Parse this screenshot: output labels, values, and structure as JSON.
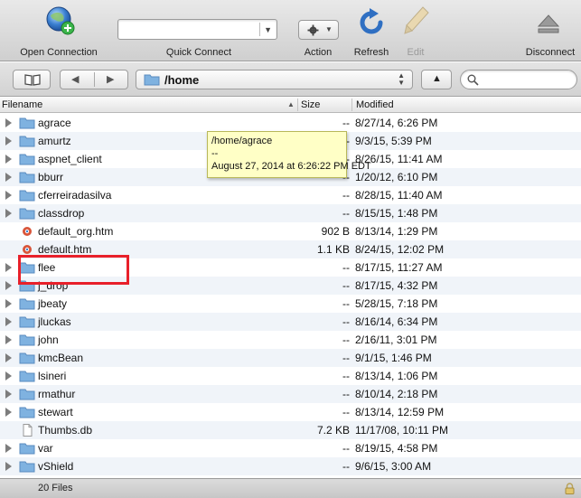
{
  "toolbar": {
    "open_connection": "Open Connection",
    "quick_connect": "Quick Connect",
    "action": "Action",
    "refresh": "Refresh",
    "edit": "Edit",
    "disconnect": "Disconnect"
  },
  "nav": {
    "path": "/home",
    "search_placeholder": ""
  },
  "columns": {
    "filename": "Filename",
    "size": "Size",
    "modified": "Modified"
  },
  "files": [
    {
      "name": "agrace",
      "size": "--",
      "modified": "8/27/14, 6:26 PM",
      "type": "folder"
    },
    {
      "name": "amurtz",
      "size": "--",
      "modified": "9/3/15, 5:39 PM",
      "type": "folder"
    },
    {
      "name": "aspnet_client",
      "size": "--",
      "modified": "8/26/15, 11:41 AM",
      "type": "folder"
    },
    {
      "name": "bburr",
      "size": "--",
      "modified": "1/20/12, 6:10 PM",
      "type": "folder"
    },
    {
      "name": "cferreiradasilva",
      "size": "--",
      "modified": "8/28/15, 11:40 AM",
      "type": "folder"
    },
    {
      "name": "classdrop",
      "size": "--",
      "modified": "8/15/15, 1:48 PM",
      "type": "folder"
    },
    {
      "name": "default_org.htm",
      "size": "902 B",
      "modified": "8/13/14, 1:29 PM",
      "type": "html"
    },
    {
      "name": "default.htm",
      "size": "1.1 KB",
      "modified": "8/24/15, 12:02 PM",
      "type": "html"
    },
    {
      "name": "flee",
      "size": "--",
      "modified": "8/17/15, 11:27 AM",
      "type": "folder"
    },
    {
      "name": "j_drop",
      "size": "--",
      "modified": "8/17/15, 4:32 PM",
      "type": "folder"
    },
    {
      "name": "jbeaty",
      "size": "--",
      "modified": "5/28/15, 7:18 PM",
      "type": "folder"
    },
    {
      "name": "jluckas",
      "size": "--",
      "modified": "8/16/14, 6:34 PM",
      "type": "folder"
    },
    {
      "name": "john",
      "size": "--",
      "modified": "2/16/11, 3:01 PM",
      "type": "folder"
    },
    {
      "name": "kmcBean",
      "size": "--",
      "modified": "9/1/15, 1:46 PM",
      "type": "folder"
    },
    {
      "name": "lsineri",
      "size": "--",
      "modified": "8/13/14, 1:06 PM",
      "type": "folder"
    },
    {
      "name": "rmathur",
      "size": "--",
      "modified": "8/10/14, 2:18 PM",
      "type": "folder"
    },
    {
      "name": "stewart",
      "size": "--",
      "modified": "8/13/14, 12:59 PM",
      "type": "folder"
    },
    {
      "name": "Thumbs.db",
      "size": "7.2 KB",
      "modified": "11/17/08, 10:11 PM",
      "type": "file"
    },
    {
      "name": "var",
      "size": "--",
      "modified": "8/19/15, 4:58 PM",
      "type": "folder"
    },
    {
      "name": "vShield",
      "size": "--",
      "modified": "9/6/15, 3:00 AM",
      "type": "folder"
    }
  ],
  "tooltip": {
    "path": "/home/agrace",
    "size": "--",
    "date": "August 27, 2014 at 6:26:22 PM EDT"
  },
  "status": {
    "count": "20 Files"
  },
  "colors": {
    "folder": "#7fb2e0",
    "highlight": "#e8202a",
    "tooltip_bg": "#ffffc6",
    "accent": "#2f6fc2"
  },
  "icons": [
    "globe-plus-icon",
    "gear-icon",
    "refresh-icon",
    "pencil-icon",
    "eject-icon",
    "bookmark-book-icon",
    "back-arrow-icon",
    "forward-arrow-icon",
    "folder-icon",
    "up-arrow-icon",
    "search-icon",
    "lock-icon"
  ]
}
